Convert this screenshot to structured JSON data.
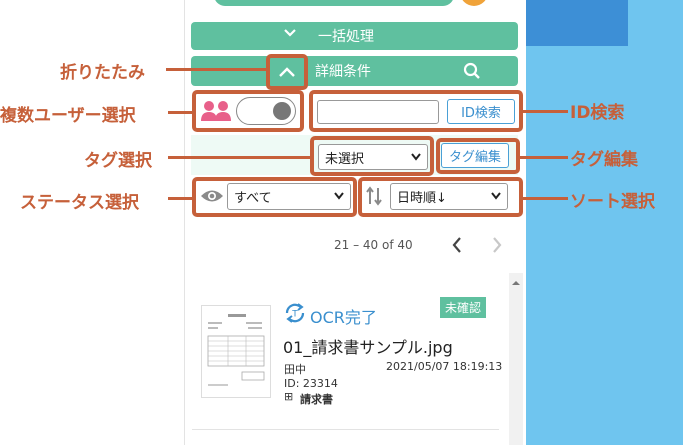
{
  "header": {
    "bulk_label": "一括処理",
    "detail_label": "詳細条件"
  },
  "filters": {
    "id_search_value": "",
    "id_search_button": "ID検索",
    "tag_select_value": "未選択",
    "tag_edit_button": "タグ編集",
    "status_select_value": "すべて",
    "sort_select_value": "日時順↓"
  },
  "pagination": {
    "range_text": "21 – 40 of 40"
  },
  "document": {
    "ocr_status": "OCR完了",
    "badge": "未確認",
    "filename": "01_請求書サンプル.jpg",
    "user": "田中",
    "timestamp": "2021/05/07 18:19:13",
    "id_text": "ID: 23314",
    "tag": "請求書",
    "tag_icon": "⊞"
  },
  "callouts": {
    "fold": "折りたたみ",
    "multi_user": "複数ユーザー選択",
    "tag_select": "タグ選択",
    "status_select": "ステータス選択",
    "id_search": "ID検索",
    "tag_edit": "タグ編集",
    "sort_select": "ソート選択"
  },
  "colors": {
    "green": "#5fc09f",
    "callout": "#c6603a",
    "blue": "#3a8fce",
    "badge": "#5fc09f"
  }
}
